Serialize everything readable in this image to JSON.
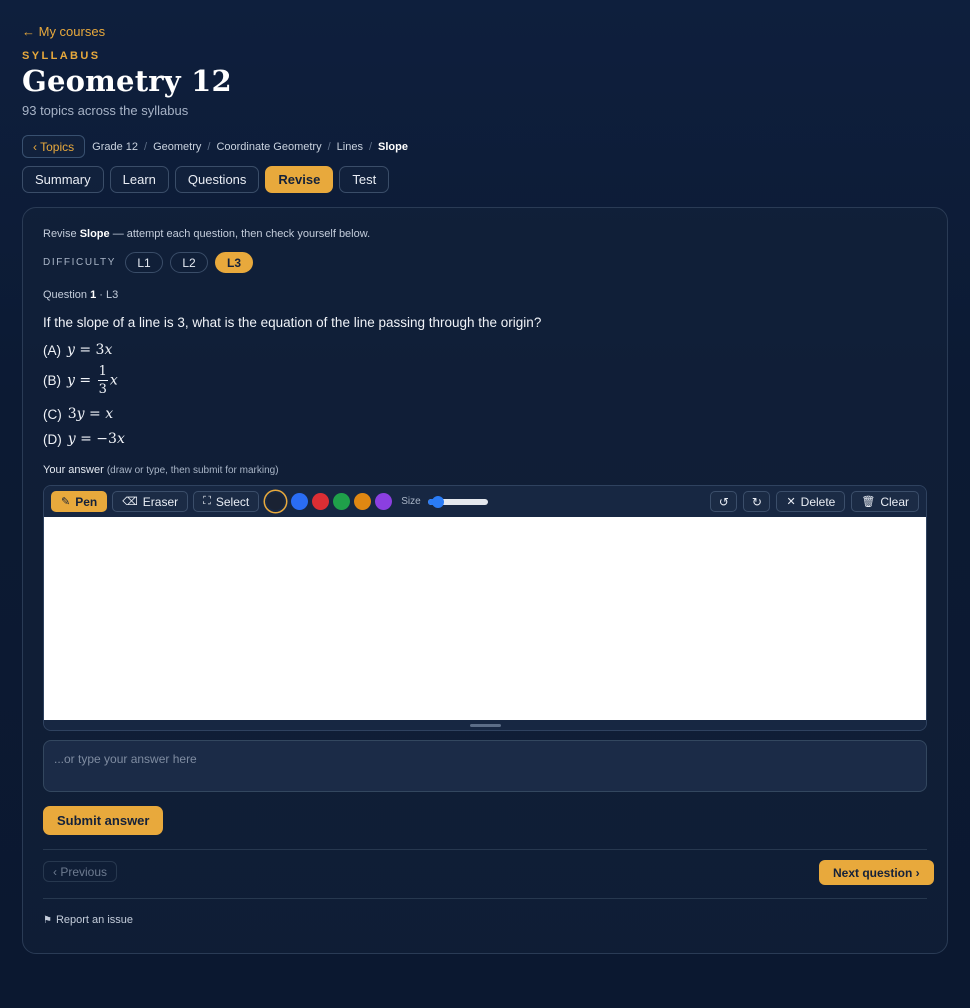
{
  "header": {
    "back_link": "← My courses",
    "eyebrow": "SYLLABUS",
    "title": "Geometry 12",
    "subtitle": "93 topics across the syllabus"
  },
  "breadcrumb": {
    "topics_button": "‹ Topics",
    "items": [
      "Grade 12",
      "Geometry",
      "Coordinate Geometry",
      "Lines",
      "Slope"
    ],
    "separator": "/"
  },
  "tabs": [
    {
      "label": "Summary",
      "active": false
    },
    {
      "label": "Learn",
      "active": false
    },
    {
      "label": "Questions",
      "active": false
    },
    {
      "label": "Revise",
      "active": true
    },
    {
      "label": "Test",
      "active": false
    }
  ],
  "revise": {
    "intro_prefix": "Revise",
    "intro_topic": "Slope",
    "intro_suffix": "— attempt each question, then check yourself below.",
    "difficulty_label": "DIFFICULTY",
    "levels": [
      {
        "label": "L1",
        "active": false
      },
      {
        "label": "L2",
        "active": false
      },
      {
        "label": "L3",
        "active": true
      }
    ]
  },
  "question": {
    "meta_prefix": "Question",
    "number": "1",
    "meta_suffix": "· L3",
    "text": "If the slope of a line is 3, what is the equation of the line passing through the origin?",
    "options": [
      {
        "label": "(A)",
        "math": "y = 3x"
      },
      {
        "label": "(B)",
        "math": "y = 1/3 x",
        "numerator": "1",
        "denominator": "3"
      },
      {
        "label": "(C)",
        "math": "3y = x"
      },
      {
        "label": "(D)",
        "math": "y = −3x"
      }
    ]
  },
  "answer": {
    "label": "Your answer",
    "hint": "(draw or type, then submit for marking)",
    "toolbar": {
      "pen": "Pen",
      "eraser": "Eraser",
      "select": "Select",
      "size_label": "Size",
      "size_value": 0.1,
      "colors": [
        "#1a2233",
        "#2a6df4",
        "#dc2e34",
        "#1fa04a",
        "#e08712",
        "#8b3fe0"
      ],
      "selected_color": "#1a2233",
      "undo_icon": "undo-icon",
      "redo_icon": "redo-icon",
      "delete": "Delete",
      "clear": "Clear"
    },
    "text_placeholder": "...or type your answer here",
    "submit": "Submit answer"
  },
  "nav": {
    "previous": "‹ Previous",
    "next": "Next question ›"
  },
  "footer": {
    "report": "Report an issue"
  }
}
